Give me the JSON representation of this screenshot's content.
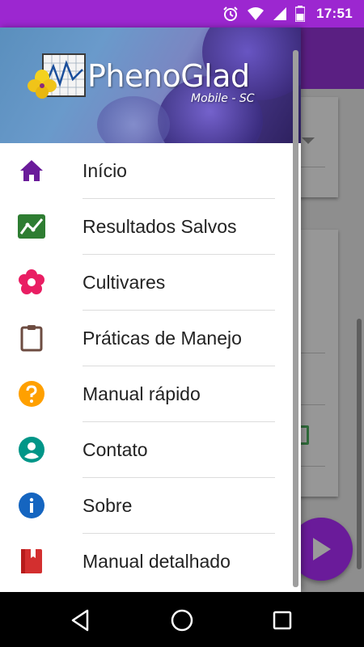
{
  "status_bar": {
    "time": "17:51",
    "icons": [
      "alarm-icon",
      "wifi-icon",
      "signal-icon",
      "battery-icon"
    ]
  },
  "drawer": {
    "header": {
      "app_name": "PhenoGlad",
      "subtitle": "Mobile - SC"
    },
    "items": [
      {
        "label": "Início",
        "icon": "home-icon",
        "color": "#6a1b9a"
      },
      {
        "label": "Resultados Salvos",
        "icon": "chart-line-icon",
        "color": "#2e7d32"
      },
      {
        "label": "Cultivares",
        "icon": "flower-icon",
        "color": "#e91e63"
      },
      {
        "label": "Práticas de Manejo",
        "icon": "clipboard-icon",
        "color": "#6d4c41"
      },
      {
        "label": "Manual rápido",
        "icon": "help-icon",
        "color": "#ffa000"
      },
      {
        "label": "Contato",
        "icon": "account-icon",
        "color": "#009688"
      },
      {
        "label": "Sobre",
        "icon": "info-icon",
        "color": "#1565c0"
      },
      {
        "label": "Manual detalhado",
        "icon": "book-icon",
        "color": "#d32f2f"
      }
    ]
  },
  "colors": {
    "status_bar": "#9c27d0",
    "accent": "#6a1b9a"
  },
  "nav_bar": {
    "buttons": [
      "back-icon",
      "home-circle-icon",
      "recents-icon"
    ]
  }
}
